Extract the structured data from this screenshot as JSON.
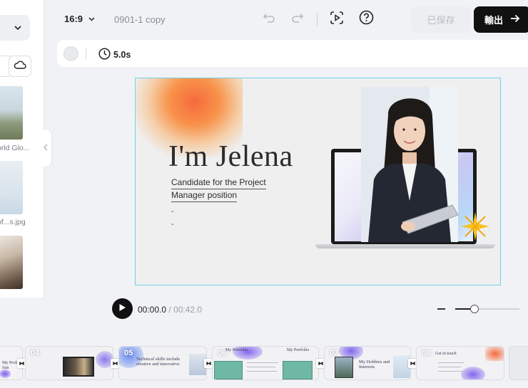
{
  "media_panel": {
    "captions": [
      "orld Glo...",
      "of...s.jpg"
    ]
  },
  "topbar": {
    "aspect_ratio": "16:9",
    "project_name": "0901-1 copy",
    "saved_label": "已保存",
    "export_label": "輸出"
  },
  "subbar": {
    "duration": "5.0s"
  },
  "slide": {
    "title": "I'm Jelena",
    "subtitle_line1": "Candidate for the Project",
    "subtitle_line2": "Manager position",
    "bullet1": "-",
    "bullet2": "-"
  },
  "playback": {
    "current_time": "00:00.0",
    "separator": " / ",
    "total_time": "00:42.0",
    "zoom_level": 0.3
  },
  "timeline": {
    "clips": [
      {
        "title": "My Profe Sun"
      },
      {
        "num": "04"
      },
      {
        "num": "05",
        "title": "Technical skills include creative and innovative"
      },
      {
        "num": "06",
        "title_left": "My Portfolio",
        "title_right": "My Portfolio"
      },
      {
        "num": "07",
        "title": "My Hobbies and Interests"
      },
      {
        "num": "08",
        "title": "Get in touch"
      }
    ]
  },
  "colors": {
    "accent_black": "#111111",
    "selection_cyan": "#6fd3e8"
  }
}
